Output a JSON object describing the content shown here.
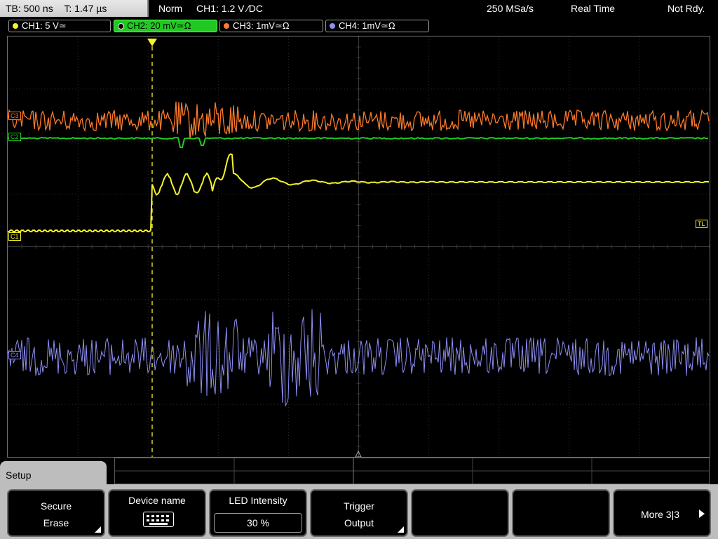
{
  "topbar": {
    "timebase": "TB: 500 ns",
    "trigger_time": "T: 1.47 µs",
    "mode": "Norm",
    "trigger_info": "CH1: 1.2 V ∕DC",
    "sample_rate": "250 MSa/s",
    "acq_mode": "Real Time",
    "status": "Not Rdy."
  },
  "channels": [
    {
      "label": "CH1: 5 V≃",
      "color": "#f5f32a"
    },
    {
      "label": "CH2: 20 mV≃Ω",
      "color": "#22c822"
    },
    {
      "label": "CH3: 1mV≃Ω",
      "color": "#ff7a2a"
    },
    {
      "label": "CH4: 1mV≃Ω",
      "color": "#8e8ef5"
    }
  ],
  "markers": {
    "ch1": "C1",
    "ch2": "C2",
    "ch3": "C3",
    "ch4": "C4",
    "trigger_level": "TL",
    "trigger_pos": "T"
  },
  "softkeys": {
    "tab": "Setup",
    "secure_erase_l1": "Secure",
    "secure_erase_l2": "Erase",
    "device_name": "Device name",
    "led_intensity": "LED Intensity",
    "led_value": "30 %",
    "trigger_output_l1": "Trigger",
    "trigger_output_l2": "Output",
    "more": "More 3|3"
  }
}
